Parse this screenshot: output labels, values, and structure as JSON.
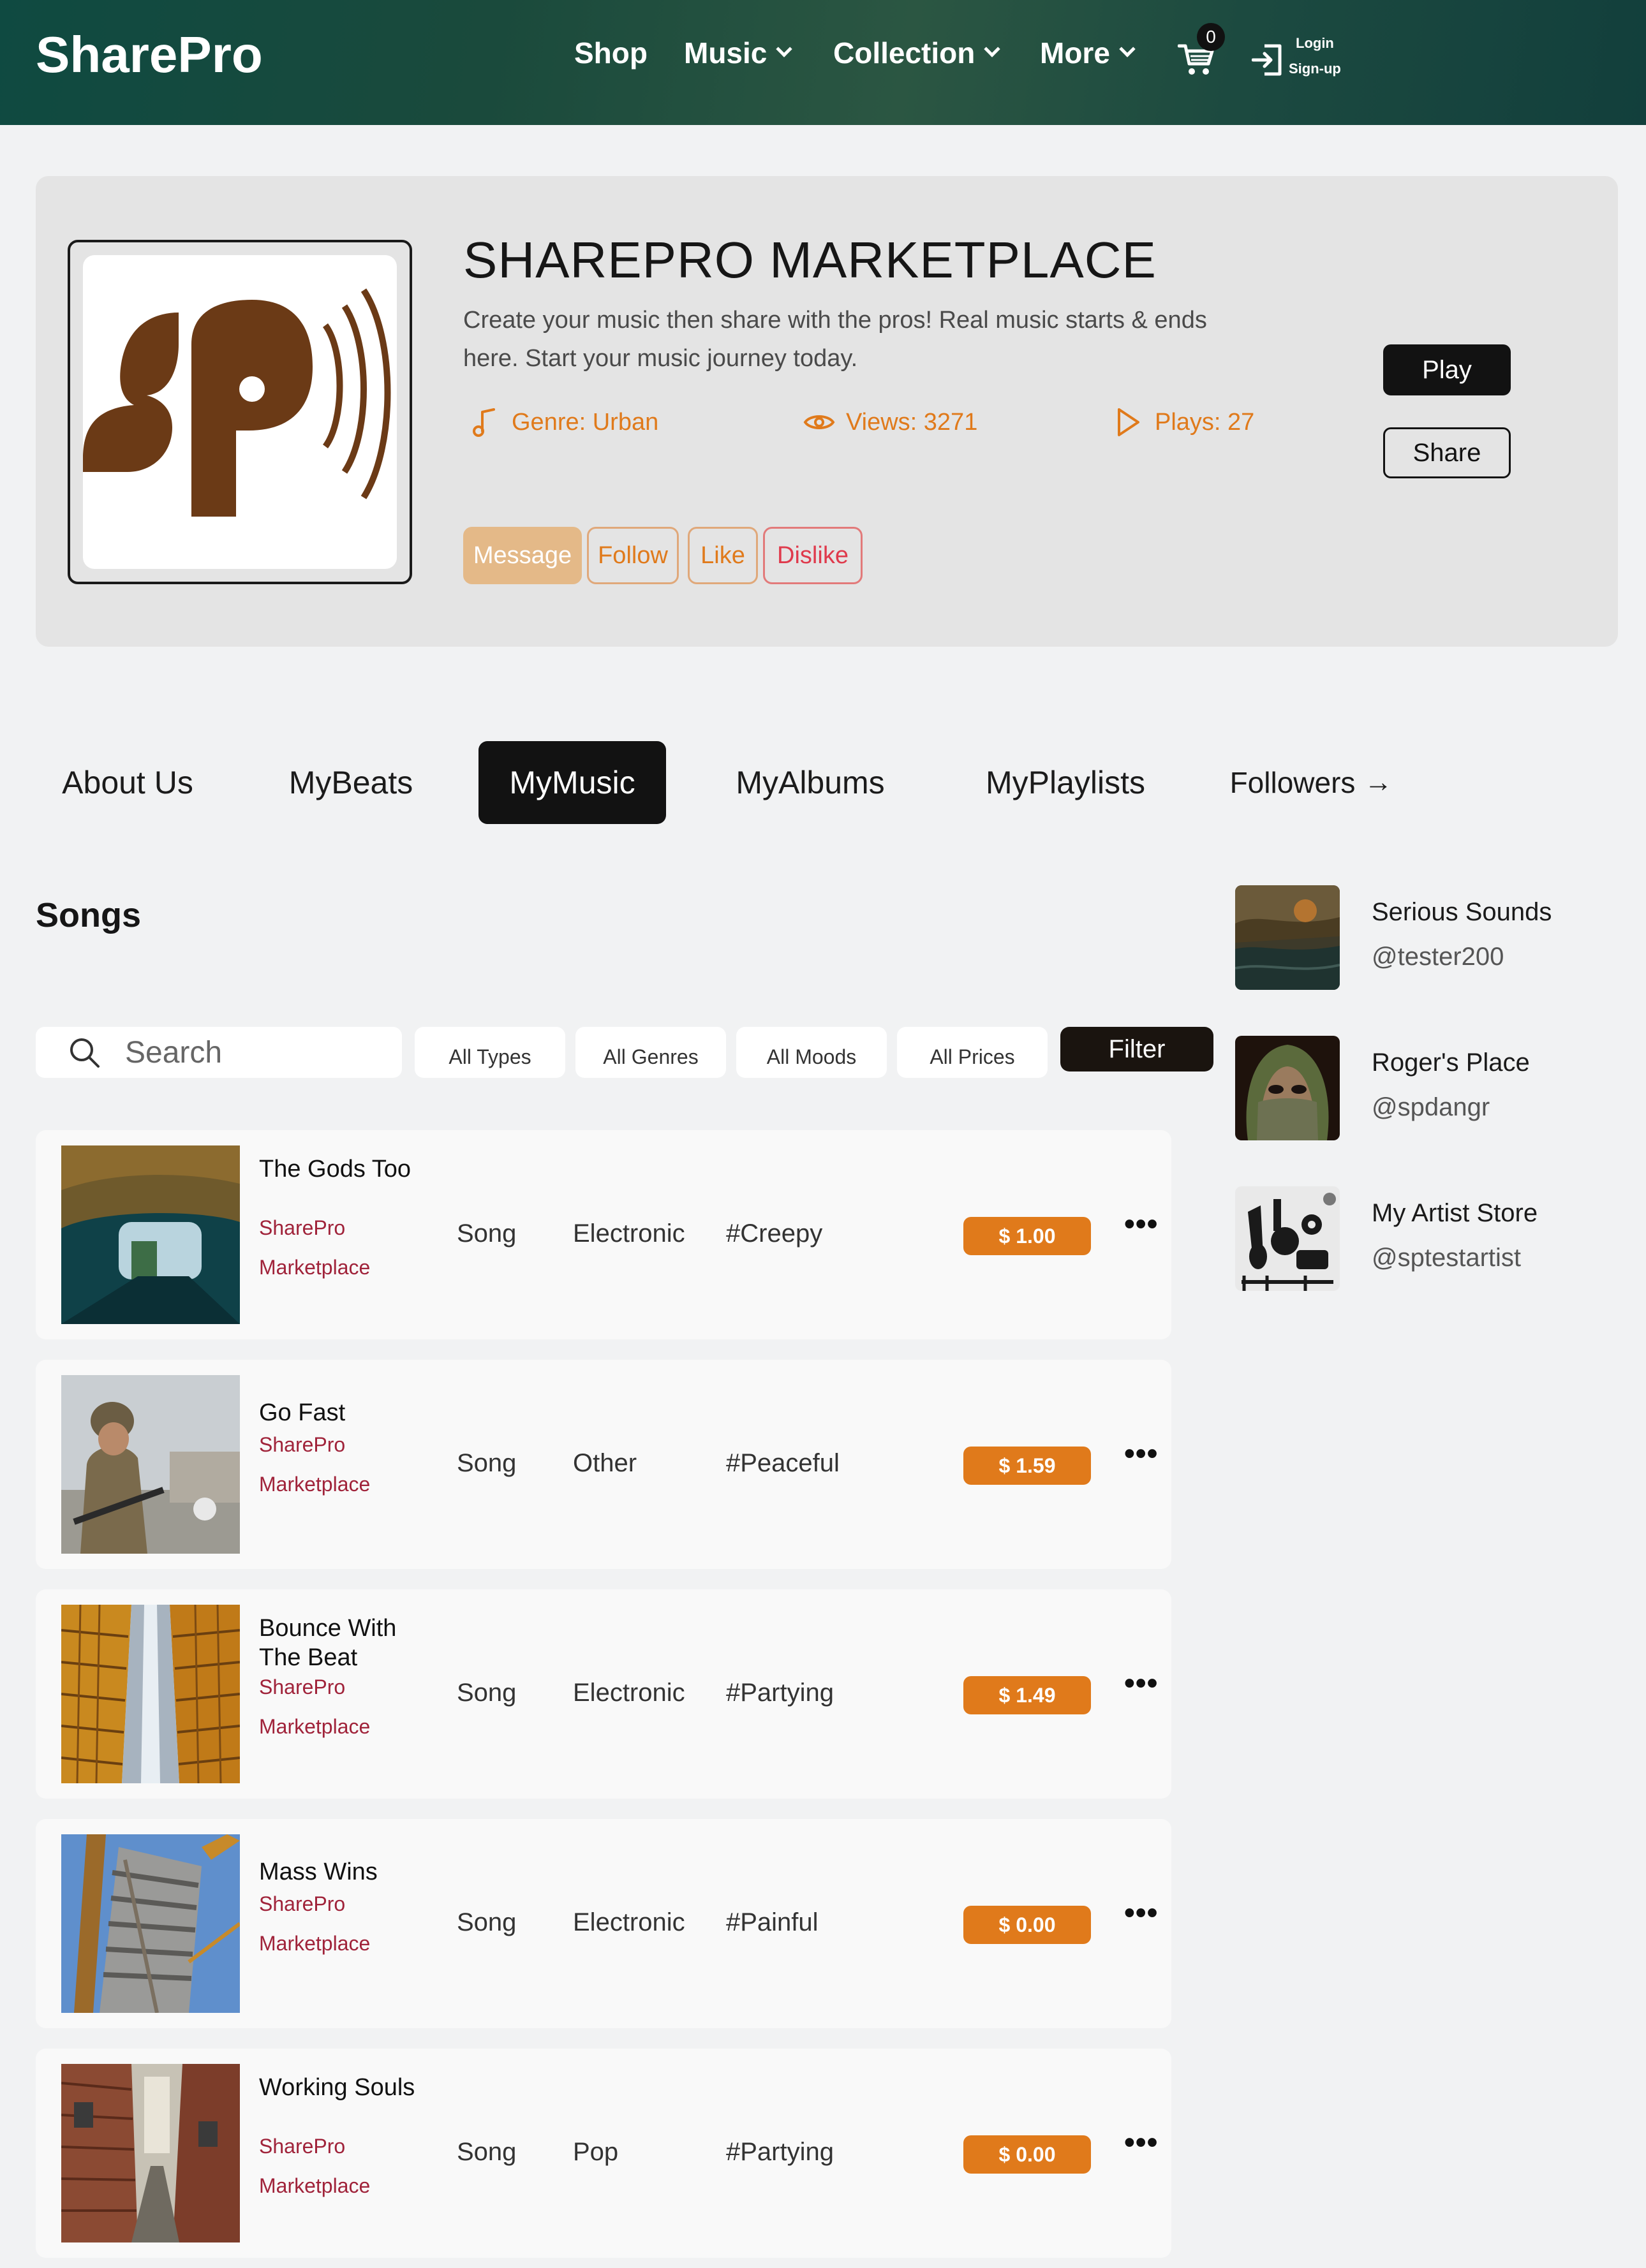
{
  "header": {
    "brand": "SharePro",
    "nav": [
      {
        "label": "Shop",
        "has_dropdown": false
      },
      {
        "label": "Music",
        "has_dropdown": true
      },
      {
        "label": "Collection",
        "has_dropdown": true
      },
      {
        "label": "More",
        "has_dropdown": true
      }
    ],
    "cart_count": "0",
    "login_label": "Login",
    "signup_label": "Sign-up",
    "colors": {
      "bg": "#1a4a3c"
    }
  },
  "profile": {
    "logo_text": "sp",
    "title": "SHAREPRO MARKETPLACE",
    "description": "Create your music then share with the pros! Real music starts & ends here. Start your music journey today.",
    "genre": "Genre: Urban",
    "views": "Views: 3271",
    "plays": "Plays: 27",
    "actions": {
      "message": "Message",
      "follow": "Follow",
      "like": "Like",
      "dislike": "Dislike"
    },
    "play_label": "Play",
    "share_label": "Share",
    "colors": {
      "accent": "#e07a1b",
      "dislike": "#df3a4c",
      "logo": "#6b3a16"
    }
  },
  "tabs": [
    {
      "label": "About Us",
      "active": false
    },
    {
      "label": "MyBeats",
      "active": false
    },
    {
      "label": "MyMusic",
      "active": true
    },
    {
      "label": "MyAlbums",
      "active": false
    },
    {
      "label": "MyPlaylists",
      "active": false
    },
    {
      "label": "Followers",
      "active": false,
      "icon": "arrow-right-icon"
    }
  ],
  "songs": {
    "heading": "Songs",
    "search_placeholder": "Search",
    "filters": [
      "All Types",
      "All Genres",
      "All Moods",
      "All Prices"
    ],
    "filter_button": "Filter",
    "items": [
      {
        "title": "The Gods Too",
        "artist_line1": "SharePro",
        "artist_line2": "Marketplace",
        "type": "Song",
        "genre": "Electronic",
        "mood": "#Creepy",
        "price": "$ 1.00",
        "image": "tunnel"
      },
      {
        "title": "Go Fast",
        "artist_line1": "SharePro",
        "artist_line2": "Marketplace",
        "type": "Song",
        "genre": "Other",
        "mood": "#Peaceful",
        "price": "$ 1.59",
        "image": "soldier"
      },
      {
        "title": "Bounce With The Beat",
        "artist_line1": "SharePro",
        "artist_line2": "Marketplace",
        "type": "Song",
        "genre": "Electronic",
        "mood": "#Partying",
        "price": "$ 1.49",
        "image": "buildings"
      },
      {
        "title": "Mass Wins",
        "artist_line1": "SharePro",
        "artist_line2": "Marketplace",
        "type": "Song",
        "genre": "Electronic",
        "mood": "#Painful",
        "price": "$ 0.00",
        "image": "construction"
      },
      {
        "title": "Working Souls",
        "artist_line1": "SharePro",
        "artist_line2": "Marketplace",
        "type": "Song",
        "genre": "Pop",
        "mood": "#Partying",
        "price": "$ 0.00",
        "image": "alley"
      }
    ]
  },
  "followers": [
    {
      "name": "Serious Sounds",
      "handle": "@tester200",
      "image": "stormy-sea"
    },
    {
      "name": "Roger's Place",
      "handle": "@spdangr",
      "image": "veiled-face"
    },
    {
      "name": "My Artist Store",
      "handle": "@sptestartist",
      "image": "instruments"
    }
  ]
}
